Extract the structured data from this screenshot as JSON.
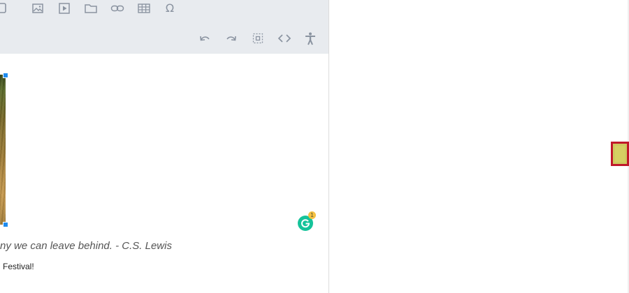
{
  "toolbar": {
    "row1_icons": [
      "checkbox-icon",
      "image-icon",
      "video-icon",
      "folder-icon",
      "link-icon",
      "table-icon",
      "special-character-icon"
    ],
    "row2_icons": [
      "undo-icon",
      "redo-icon",
      "select-all-icon",
      "source-code-icon",
      "accessibility-icon"
    ],
    "omega_glyph": "Ω"
  },
  "content": {
    "quote": "ny we can leave behind. - C.S. Lewis",
    "caption": "Festival!"
  },
  "grammarly": {
    "letter": "G",
    "badge_count": "1"
  },
  "colors": {
    "toolbar_bg": "#e8ebef",
    "icon_gray": "#8a93a0",
    "handle_blue": "#1f8cf0",
    "grammarly_green": "#15c39a",
    "swatch_fill": "#cfc85f",
    "swatch_border": "#c0182a"
  }
}
